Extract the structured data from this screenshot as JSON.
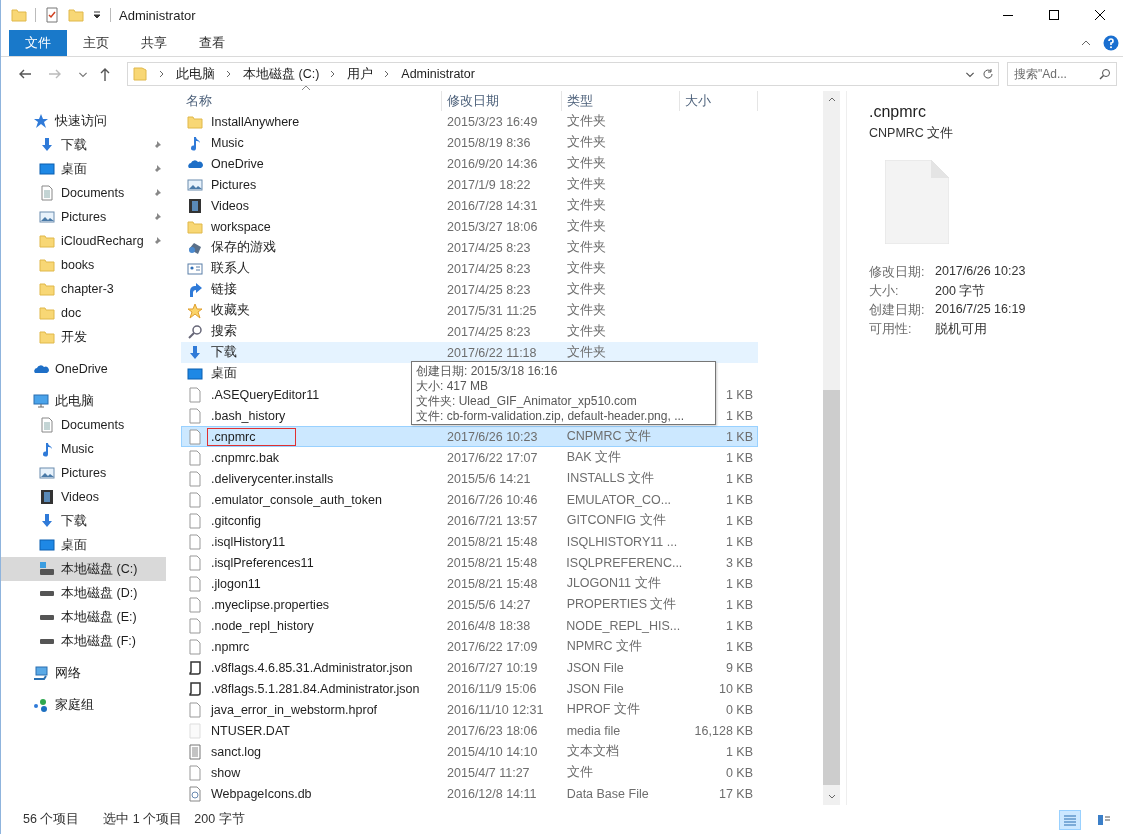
{
  "window": {
    "title": "Administrator"
  },
  "ribbon": {
    "tabs": [
      {
        "label": "文件",
        "selected": true
      },
      {
        "label": "主页",
        "selected": false
      },
      {
        "label": "共享",
        "selected": false
      },
      {
        "label": "查看",
        "selected": false
      }
    ]
  },
  "address_bar": {
    "segments": [
      "此电脑",
      "本地磁盘 (C:)",
      "用户",
      "Administrator"
    ],
    "search": {
      "placeholder": "搜索\"Ad..."
    }
  },
  "sidebar": {
    "sections": [
      {
        "label": "快速访问",
        "kind": "star",
        "selected": false,
        "children": [
          {
            "label": "下载",
            "kind": "download",
            "pinned": true,
            "selected": false
          },
          {
            "label": "桌面",
            "kind": "desktop",
            "pinned": true,
            "selected": false
          },
          {
            "label": "Documents",
            "kind": "document",
            "pinned": true,
            "selected": false
          },
          {
            "label": "Pictures",
            "kind": "pictures",
            "pinned": true,
            "selected": false
          },
          {
            "label": "iCloudRecharg",
            "kind": "folder",
            "pinned": true,
            "selected": false
          },
          {
            "label": "books",
            "kind": "folder",
            "pinned": false,
            "selected": false
          },
          {
            "label": "chapter-3",
            "kind": "folder",
            "pinned": false,
            "selected": false
          },
          {
            "label": "doc",
            "kind": "folder",
            "pinned": false,
            "selected": false
          },
          {
            "label": "开发",
            "kind": "folder",
            "pinned": false,
            "selected": false
          }
        ]
      },
      {
        "label": "OneDrive",
        "kind": "onedrive",
        "selected": false
      },
      {
        "label": "此电脑",
        "kind": "pc",
        "selected": false,
        "children": [
          {
            "label": "Documents",
            "kind": "document",
            "pinned": false,
            "selected": false
          },
          {
            "label": "Music",
            "kind": "music",
            "pinned": false,
            "selected": false
          },
          {
            "label": "Pictures",
            "kind": "pictures",
            "pinned": false,
            "selected": false
          },
          {
            "label": "Videos",
            "kind": "videos",
            "pinned": false,
            "selected": false
          },
          {
            "label": "下载",
            "kind": "download",
            "pinned": false,
            "selected": false
          },
          {
            "label": "桌面",
            "kind": "desktop",
            "pinned": false,
            "selected": false
          },
          {
            "label": "本地磁盘 (C:)",
            "kind": "drive-system",
            "pinned": false,
            "selected": true
          },
          {
            "label": "本地磁盘 (D:)",
            "kind": "drive",
            "pinned": false,
            "selected": false
          },
          {
            "label": "本地磁盘 (E:)",
            "kind": "drive",
            "pinned": false,
            "selected": false
          },
          {
            "label": "本地磁盘 (F:)",
            "kind": "drive",
            "pinned": false,
            "selected": false
          }
        ]
      },
      {
        "label": "网络",
        "kind": "network",
        "selected": false
      },
      {
        "label": "家庭组",
        "kind": "homegroup",
        "selected": false
      }
    ]
  },
  "file_list": {
    "columns": [
      "名称",
      "修改日期",
      "类型",
      "大小"
    ],
    "rows": [
      {
        "name": "InstallAnywhere",
        "date": "2015/3/23 16:49",
        "type": "文件夹",
        "size": "",
        "kind": "folder",
        "selected": false,
        "hovered": false,
        "annotated": false
      },
      {
        "name": "Music",
        "date": "2015/8/19 8:36",
        "type": "文件夹",
        "size": "",
        "kind": "music",
        "selected": false,
        "hovered": false,
        "annotated": false
      },
      {
        "name": "OneDrive",
        "date": "2016/9/20 14:36",
        "type": "文件夹",
        "size": "",
        "kind": "onedrive",
        "selected": false,
        "hovered": false,
        "annotated": false
      },
      {
        "name": "Pictures",
        "date": "2017/1/9 18:22",
        "type": "文件夹",
        "size": "",
        "kind": "pictures",
        "selected": false,
        "hovered": false,
        "annotated": false
      },
      {
        "name": "Videos",
        "date": "2016/7/28 14:31",
        "type": "文件夹",
        "size": "",
        "kind": "videos",
        "selected": false,
        "hovered": false,
        "annotated": false
      },
      {
        "name": "workspace",
        "date": "2015/3/27 18:06",
        "type": "文件夹",
        "size": "",
        "kind": "folder",
        "selected": false,
        "hovered": false,
        "annotated": false
      },
      {
        "name": "保存的游戏",
        "date": "2017/4/25 8:23",
        "type": "文件夹",
        "size": "",
        "kind": "games",
        "selected": false,
        "hovered": false,
        "annotated": false
      },
      {
        "name": "联系人",
        "date": "2017/4/25 8:23",
        "type": "文件夹",
        "size": "",
        "kind": "contacts",
        "selected": false,
        "hovered": false,
        "annotated": false
      },
      {
        "name": "链接",
        "date": "2017/4/25 8:23",
        "type": "文件夹",
        "size": "",
        "kind": "links",
        "selected": false,
        "hovered": false,
        "annotated": false
      },
      {
        "name": "收藏夹",
        "date": "2017/5/31 11:25",
        "type": "文件夹",
        "size": "",
        "kind": "favorites",
        "selected": false,
        "hovered": false,
        "annotated": false
      },
      {
        "name": "搜索",
        "date": "2017/4/25 8:23",
        "type": "文件夹",
        "size": "",
        "kind": "search",
        "selected": false,
        "hovered": false,
        "annotated": false
      },
      {
        "name": "下载",
        "date": "2017/6/22 11:18",
        "type": "文件夹",
        "size": "",
        "kind": "download",
        "selected": false,
        "hovered": true,
        "annotated": false
      },
      {
        "name": "桌面",
        "date": "",
        "type": "",
        "size": "",
        "kind": "desktop",
        "selected": false,
        "hovered": false,
        "annotated": false
      },
      {
        "name": ".ASEQueryEditor11",
        "date": "",
        "type": "",
        "size": "1 KB",
        "kind": "file",
        "selected": false,
        "hovered": false,
        "annotated": false
      },
      {
        "name": ".bash_history",
        "date": "",
        "type": "",
        "size": "1 KB",
        "kind": "file",
        "selected": false,
        "hovered": false,
        "annotated": false
      },
      {
        "name": ".cnpmrc",
        "date": "2017/6/26 10:23",
        "type": "CNPMRC 文件",
        "size": "1 KB",
        "kind": "file",
        "selected": true,
        "hovered": false,
        "annotated": true
      },
      {
        "name": ".cnpmrc.bak",
        "date": "2017/6/22 17:07",
        "type": "BAK 文件",
        "size": "1 KB",
        "kind": "file",
        "selected": false,
        "hovered": false,
        "annotated": false
      },
      {
        "name": ".deliverycenter.installs",
        "date": "2015/5/6 14:21",
        "type": "INSTALLS 文件",
        "size": "1 KB",
        "kind": "file",
        "selected": false,
        "hovered": false,
        "annotated": false
      },
      {
        "name": ".emulator_console_auth_token",
        "date": "2016/7/26 10:46",
        "type": "EMULATOR_CO...",
        "size": "1 KB",
        "kind": "file",
        "selected": false,
        "hovered": false,
        "annotated": false
      },
      {
        "name": ".gitconfig",
        "date": "2016/7/21 13:57",
        "type": "GITCONFIG 文件",
        "size": "1 KB",
        "kind": "file",
        "selected": false,
        "hovered": false,
        "annotated": false
      },
      {
        "name": ".isqlHistory11",
        "date": "2015/8/21 15:48",
        "type": "ISQLHISTORY11 ...",
        "size": "1 KB",
        "kind": "file",
        "selected": false,
        "hovered": false,
        "annotated": false
      },
      {
        "name": ".isqlPreferences11",
        "date": "2015/8/21 15:48",
        "type": "ISQLPREFERENC...",
        "size": "3 KB",
        "kind": "file",
        "selected": false,
        "hovered": false,
        "annotated": false
      },
      {
        "name": ".jlogon11",
        "date": "2015/8/21 15:48",
        "type": "JLOGON11 文件",
        "size": "1 KB",
        "kind": "file",
        "selected": false,
        "hovered": false,
        "annotated": false
      },
      {
        "name": ".myeclipse.properties",
        "date": "2015/5/6 14:27",
        "type": "PROPERTIES 文件",
        "size": "1 KB",
        "kind": "file",
        "selected": false,
        "hovered": false,
        "annotated": false
      },
      {
        "name": ".node_repl_history",
        "date": "2016/4/8 18:38",
        "type": "NODE_REPL_HIS...",
        "size": "1 KB",
        "kind": "file",
        "selected": false,
        "hovered": false,
        "annotated": false
      },
      {
        "name": ".npmrc",
        "date": "2017/6/22 17:09",
        "type": "NPMRC 文件",
        "size": "1 KB",
        "kind": "file",
        "selected": false,
        "hovered": false,
        "annotated": false
      },
      {
        "name": ".v8flags.4.6.85.31.Administrator.json",
        "date": "2016/7/27 10:19",
        "type": "JSON File",
        "size": "9 KB",
        "kind": "json",
        "selected": false,
        "hovered": false,
        "annotated": false
      },
      {
        "name": ".v8flags.5.1.281.84.Administrator.json",
        "date": "2016/11/9 15:06",
        "type": "JSON File",
        "size": "10 KB",
        "kind": "json",
        "selected": false,
        "hovered": false,
        "annotated": false
      },
      {
        "name": "java_error_in_webstorm.hprof",
        "date": "2016/11/10 12:31",
        "type": "HPROF 文件",
        "size": "0 KB",
        "kind": "file",
        "selected": false,
        "hovered": false,
        "annotated": false
      },
      {
        "name": "NTUSER.DAT",
        "date": "2017/6/23 18:06",
        "type": "media file",
        "size": "16,128 KB",
        "kind": "blank",
        "selected": false,
        "hovered": false,
        "annotated": false
      },
      {
        "name": "sanct.log",
        "date": "2015/4/10 14:10",
        "type": "文本文档",
        "size": "1 KB",
        "kind": "text",
        "selected": false,
        "hovered": false,
        "annotated": false
      },
      {
        "name": "show",
        "date": "2015/4/7 11:27",
        "type": "文件",
        "size": "0 KB",
        "kind": "file",
        "selected": false,
        "hovered": false,
        "annotated": false
      },
      {
        "name": "WebpageIcons.db",
        "date": "2016/12/8 14:11",
        "type": "Data Base File",
        "size": "17 KB",
        "kind": "db",
        "selected": false,
        "hovered": false,
        "annotated": false
      }
    ],
    "tooltip": [
      "创建日期: 2015/3/18 16:16",
      "大小: 417 MB",
      "文件夹: Ulead_GIF_Animator_xp510.com",
      "文件: cb-form-validation.zip, default-header.png, ..."
    ]
  },
  "preview": {
    "name": ".cnpmrc",
    "type": "CNPMRC 文件",
    "properties": [
      {
        "label": "修改日期:",
        "value": "2017/6/26 10:23"
      },
      {
        "label": "大小:",
        "value": "200 字节"
      },
      {
        "label": "创建日期:",
        "value": "2016/7/25 16:19"
      },
      {
        "label": "可用性:",
        "value": "脱机可用"
      }
    ]
  },
  "status_bar": {
    "item_count": "56 个项目",
    "selection": "选中 1 个项目",
    "selection_size": "200 字节",
    "views": [
      {
        "kind": "details",
        "selected": true
      },
      {
        "kind": "tiles",
        "selected": false
      }
    ]
  }
}
